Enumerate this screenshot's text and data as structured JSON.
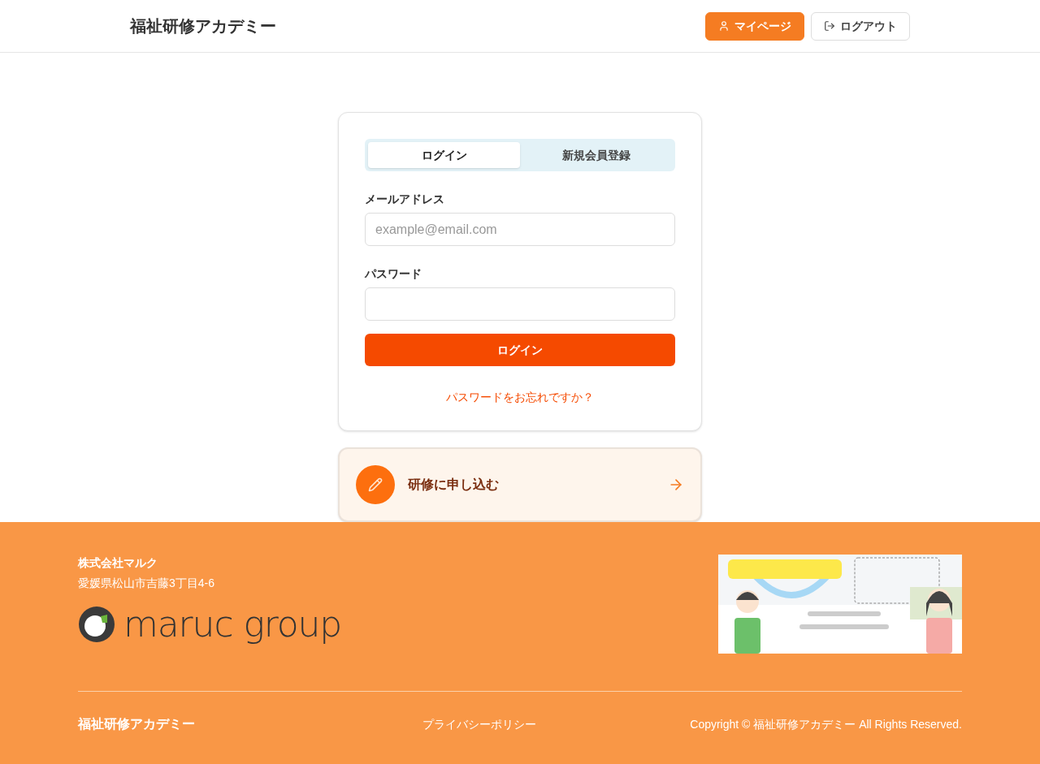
{
  "header": {
    "site_title": "福祉研修アカデミー",
    "buttons": [
      {
        "label": "マイページ",
        "kind": "primary"
      },
      {
        "label": "ログアウト",
        "kind": "outline"
      }
    ]
  },
  "login_card": {
    "tabs": [
      {
        "label": "ログイン",
        "selected": true
      },
      {
        "label": "新規会員登録",
        "selected": false
      }
    ],
    "fields": [
      {
        "label": "メールアドレス",
        "placeholder": "example@email.com"
      },
      {
        "label": "パスワード"
      }
    ],
    "submit": "ログイン",
    "forgot_link": "パスワードをお忘れですか？"
  },
  "apply_card": {
    "label": "研修に申し込む"
  },
  "footer": {
    "company": "株式会社マルク",
    "address": "愛媛県松山市吉藤3丁目4-6",
    "logo_text": "maruc group",
    "site_title": "福祉研修アカデミー",
    "policy_link": "プライバシーポリシー",
    "copyright": "Copyright © 福祉研修アカデミー All Rights Reserved."
  }
}
